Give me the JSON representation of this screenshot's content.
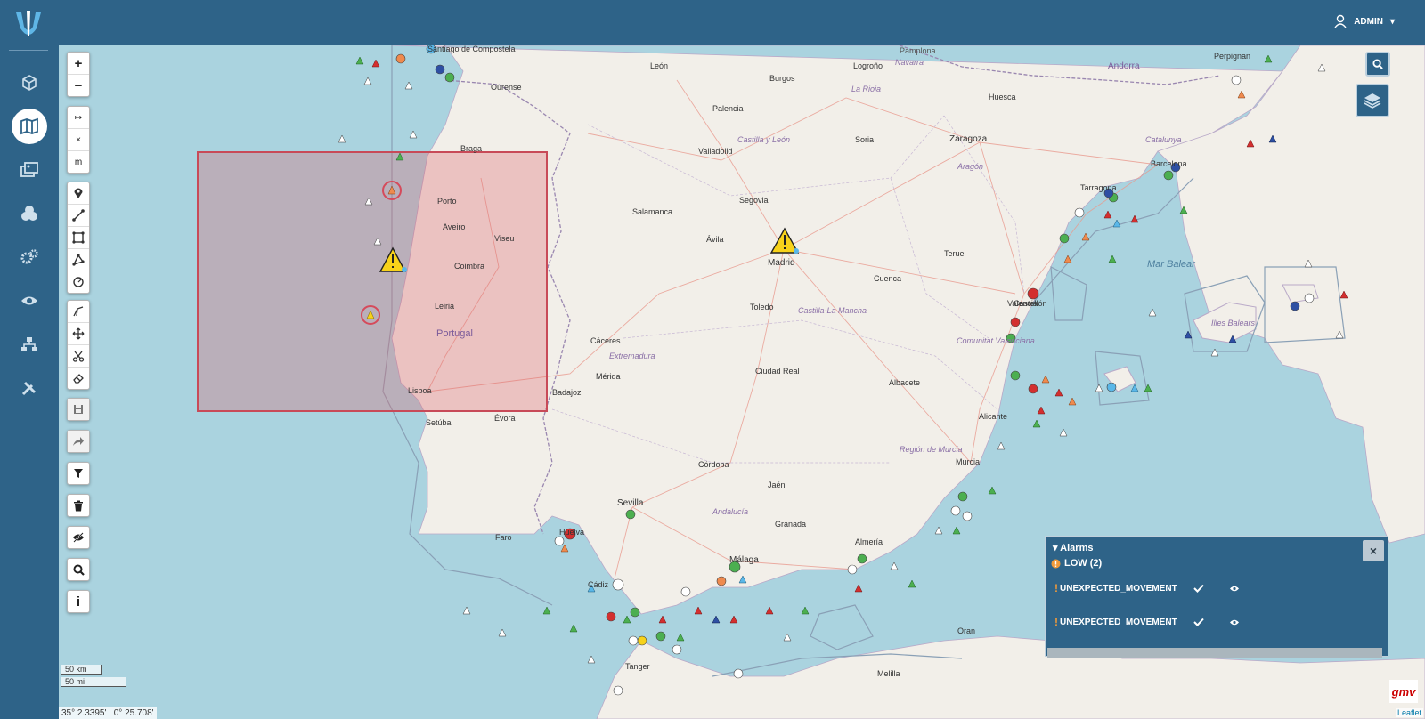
{
  "app": {
    "brand_icon": "trident-logo"
  },
  "user": {
    "name": "ADMIN",
    "icon": "user-icon",
    "caret": "▾"
  },
  "sidebar": {
    "items": [
      {
        "name": "box",
        "icon": "cube-icon",
        "active": false
      },
      {
        "name": "map",
        "icon": "map-icon",
        "active": true
      },
      {
        "name": "images",
        "icon": "images-icon",
        "active": false
      },
      {
        "name": "cubes",
        "icon": "cubes-icon",
        "active": false
      },
      {
        "name": "settings",
        "icon": "gears-icon",
        "active": false
      },
      {
        "name": "watch",
        "icon": "eye-icon",
        "active": false
      },
      {
        "name": "network",
        "icon": "sitemap-icon",
        "active": false
      },
      {
        "name": "tools",
        "icon": "tools-icon",
        "active": false
      }
    ]
  },
  "map_controls": {
    "zoom_in": "+",
    "zoom_out": "−",
    "measure_start": "↦",
    "measure_clear": "×",
    "measure_unit": "m",
    "info": "i"
  },
  "scale": {
    "km": "50 km",
    "mi": "50 mi"
  },
  "coords": "35° 2.3395' : 0° 25.708'",
  "alarms": {
    "title": "Alarms",
    "close": "×",
    "level_label": "LOW (2)",
    "items": [
      {
        "type": "UNEXPECTED_MOVEMENT"
      },
      {
        "type": "UNEXPECTED_MOVEMENT"
      }
    ]
  },
  "attribution": {
    "gmv": "gmv",
    "leaflet": "Leaflet"
  },
  "map_labels": {
    "countries": [
      "Andorra",
      "Portugal"
    ],
    "seas": [
      "Mar Balear"
    ],
    "cities": [
      "Madrid",
      "Zaragoza",
      "Barcelona",
      "Valencia",
      "Sevilla",
      "Málaga",
      "Murcia",
      "Lisboa",
      "Porto",
      "Coimbra",
      "Toledo",
      "Córdoba",
      "Granada",
      "Alicante",
      "Salamanca",
      "Valladolid",
      "Burgos",
      "León",
      "Badajoz",
      "Cáceres",
      "Cuenca",
      "Albacete",
      "Huesca",
      "Teruel",
      "Palencia",
      "Segovia",
      "Ávila",
      "Soria",
      "Logroño",
      "Jaén",
      "Mérida",
      "Évora",
      "Faro",
      "Ciudad Real",
      "Braga",
      "Viseu",
      "Aveiro",
      "Leiria",
      "Setúbal",
      "Pamplona",
      "Santiago de Compostela",
      "Ourense",
      "Oran",
      "Tanger",
      "Melilla",
      "Castellón",
      "Tarragona",
      "Huelva",
      "Cádiz",
      "Almería",
      "Perpignan"
    ],
    "regions": [
      "Castilla y León",
      "Aragón",
      "Castilla-La Mancha",
      "Extremadura",
      "Andalucía",
      "Región de Murcia",
      "Comunitat Valenciana",
      "Catalunya",
      "La Rioja",
      "Illes Balears",
      "Navarra"
    ]
  },
  "colors": {
    "primary": "#2e6388",
    "sea": "#aad3df",
    "land": "#f2efe9",
    "zone": "#e28080",
    "warning": "#f7d21a"
  }
}
